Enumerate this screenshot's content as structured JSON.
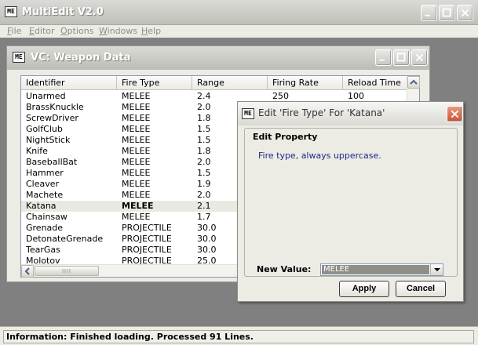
{
  "app": {
    "title": "MultiEdit V2.0",
    "menu": [
      {
        "label": "File",
        "u": "F",
        "rest": "ile"
      },
      {
        "label": "Editor",
        "u": "E",
        "rest": "ditor"
      },
      {
        "label": "Options",
        "u": "O",
        "rest": "ptions"
      },
      {
        "label": "Windows",
        "u": "W",
        "rest": "indows"
      },
      {
        "label": "Help",
        "u": "H",
        "rest": "elp"
      }
    ]
  },
  "child_window": {
    "title": "VC: Weapon Data",
    "columns": [
      "Identifier",
      "Fire Type",
      "Range",
      "Firing Rate",
      "Reload Time"
    ],
    "rows": [
      [
        "Unarmed",
        "MELEE",
        "2.4",
        "250",
        "100"
      ],
      [
        "BrassKnuckle",
        "MELEE",
        "2.0",
        "",
        ""
      ],
      [
        "ScrewDriver",
        "MELEE",
        "1.8",
        "",
        ""
      ],
      [
        "GolfClub",
        "MELEE",
        "1.5",
        "",
        ""
      ],
      [
        "NightStick",
        "MELEE",
        "1.5",
        "",
        ""
      ],
      [
        "Knife",
        "MELEE",
        "1.8",
        "",
        ""
      ],
      [
        "BaseballBat",
        "MELEE",
        "2.0",
        "",
        ""
      ],
      [
        "Hammer",
        "MELEE",
        "1.5",
        "",
        ""
      ],
      [
        "Cleaver",
        "MELEE",
        "1.9",
        "",
        ""
      ],
      [
        "Machete",
        "MELEE",
        "2.0",
        "",
        ""
      ],
      [
        "Katana",
        "MELEE",
        "2.1",
        "",
        ""
      ],
      [
        "Chainsaw",
        "MELEE",
        "1.7",
        "",
        ""
      ],
      [
        "Grenade",
        "PROJECTILE",
        "30.0",
        "",
        ""
      ],
      [
        "DetonateGrenade",
        "PROJECTILE",
        "30.0",
        "",
        ""
      ],
      [
        "TearGas",
        "PROJECTILE",
        "30.0",
        "",
        ""
      ],
      [
        "Molotov",
        "PROJECTILE",
        "25.0",
        "",
        ""
      ]
    ],
    "selected_row_index": 10
  },
  "dialog": {
    "title": "Edit 'Fire Type' For 'Katana'",
    "group_title": "Edit Property",
    "help_text": "Fire type, always uppercase.",
    "new_value_label": "New Value:",
    "new_value": "MELEE",
    "apply_label": "Apply",
    "cancel_label": "Cancel"
  },
  "status": {
    "text": "Information: Finished loading. Processed 91 Lines."
  },
  "icons": {
    "app": "multiedit-app-icon",
    "minimize": "minimize-icon",
    "maximize": "maximize-icon",
    "close": "close-icon"
  }
}
